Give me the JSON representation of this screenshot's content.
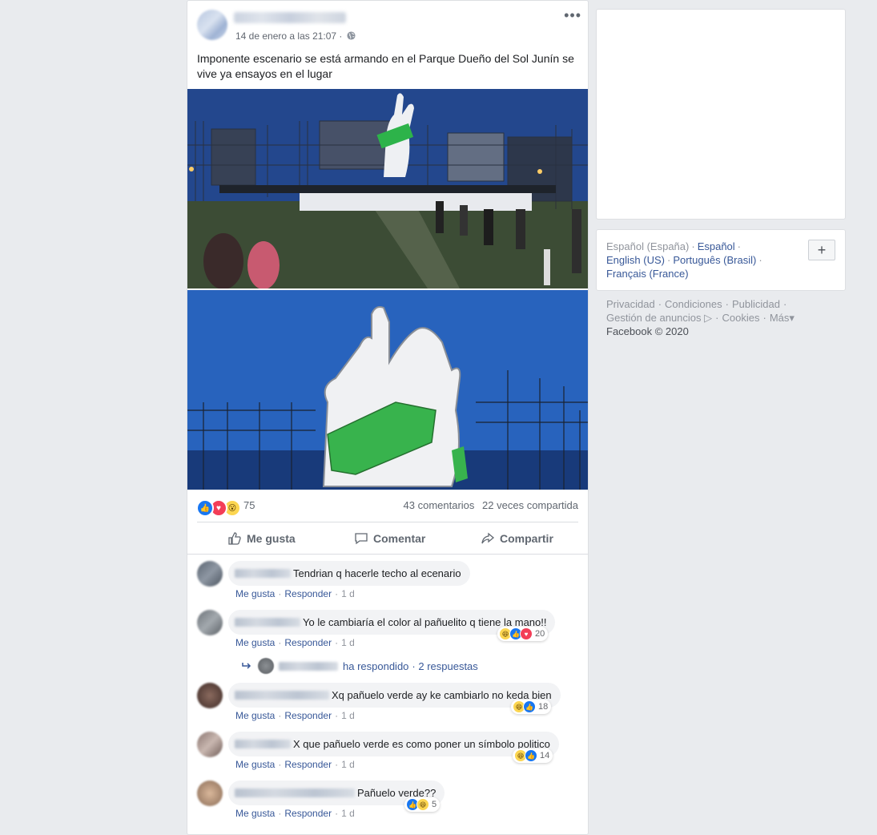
{
  "post": {
    "timestamp": "14 de enero a las 21:07 ·",
    "more_label": "•••",
    "text": "Imponente escenario se está armando en el Parque Dueño del Sol Junín se vive ya ensayos en el lugar",
    "reaction_count": "75",
    "comments_count": "43 comentarios",
    "shares_count": "22 veces compartida",
    "actions": {
      "like": "Me gusta",
      "comment": "Comentar",
      "share": "Compartir"
    }
  },
  "comments": [
    {
      "text": "Tendrian q hacerle techo al ecenario",
      "like": "Me gusta",
      "reply": "Responder",
      "time": "1 d"
    },
    {
      "text": "Yo le cambiaría el color al pañuelito q tiene la mano!!",
      "like": "Me gusta",
      "reply": "Responder",
      "time": "1 d",
      "reactions": "20"
    },
    {
      "text": "Xq pañuelo verde ay ke cambiarlo no keda bien",
      "like": "Me gusta",
      "reply": "Responder",
      "time": "1 d",
      "reactions": "18"
    },
    {
      "text": "X que pañuelo verde es como poner un símbolo politico",
      "like": "Me gusta",
      "reply": "Responder",
      "time": "1 d",
      "reactions": "14"
    },
    {
      "text": "Pañuelo verde??",
      "like": "Me gusta",
      "reply": "Responder",
      "time": "1 d",
      "reactions": "5"
    }
  ],
  "replies": {
    "responded": "ha respondido",
    "count": "· 2 respuestas"
  },
  "languages": {
    "current": "Español (España)",
    "items": [
      "Español",
      "English (US)",
      "Português (Brasil)",
      "Français (France)"
    ],
    "add_label": "+"
  },
  "footer": {
    "links": [
      "Privacidad",
      "Condiciones",
      "Publicidad",
      "Gestión de anuncios",
      "Cookies",
      "Más"
    ],
    "adchoices_icon": "▷",
    "more_arrow": "▾",
    "copyright": "Facebook © 2020"
  },
  "colors": {
    "link": "#385898",
    "background": "#e9ebee",
    "like_blue": "#1877f2",
    "love_red": "#f33e58",
    "wow_yellow": "#fcd651"
  }
}
